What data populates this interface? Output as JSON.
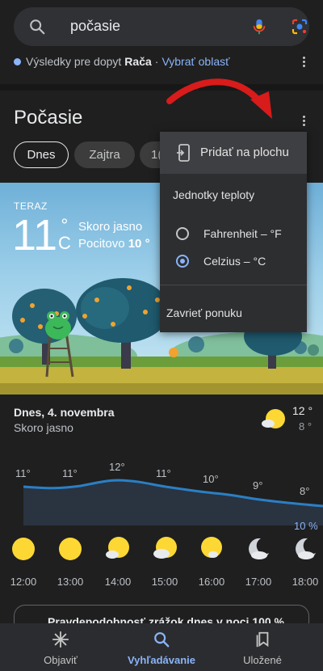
{
  "search": {
    "query": "počasie"
  },
  "results_line": {
    "prefix": "Výsledky pre dopyt",
    "place": "Rača",
    "separator": "·",
    "link": "Vybrať oblasť"
  },
  "card": {
    "title": "Počasie"
  },
  "chips": [
    {
      "label": "Dnes",
      "selected": true
    },
    {
      "label": "Zajtra",
      "selected": false
    },
    {
      "label": "1(",
      "selected": false
    }
  ],
  "now": {
    "label": "TERAZ",
    "temp": "11",
    "degree": "°",
    "unit": "C",
    "condition": "Skoro jasno",
    "feels_prefix": "Pocitovo",
    "feels_value": "10 °"
  },
  "menu": {
    "add_label": "Pridať na plochu",
    "units_heading": "Jednotky teploty",
    "options": [
      {
        "label": "Fahrenheit – °F",
        "selected": false
      },
      {
        "label": "Celzius – °C",
        "selected": true
      }
    ],
    "close_label": "Zavrieť ponuku"
  },
  "day": {
    "date": "Dnes, 4. novembra",
    "condition": "Skoro jasno",
    "high": "12 °",
    "low": "8 °"
  },
  "hourly": [
    {
      "time": "12:00",
      "temp": "11°",
      "icon": "sun"
    },
    {
      "time": "13:00",
      "temp": "11°",
      "icon": "sun"
    },
    {
      "time": "14:00",
      "temp": "12°",
      "icon": "sun-cloud"
    },
    {
      "time": "15:00",
      "temp": "11°",
      "icon": "sun-cloud"
    },
    {
      "time": "16:00",
      "temp": "10°",
      "icon": "sun-cloud"
    },
    {
      "time": "17:00",
      "temp": "9°",
      "icon": "moon-cloud"
    },
    {
      "time": "18:00",
      "temp": "8°",
      "icon": "moon-cloud"
    }
  ],
  "precip_label": "10 %",
  "precip_card": "Pravdepodobnosť zrážok dnes v noci 100 %",
  "nav": [
    {
      "label": "Objaviť",
      "icon": "asterisk-icon",
      "active": false
    },
    {
      "label": "Vyhľadávanie",
      "icon": "search-icon",
      "active": true
    },
    {
      "label": "Uložené",
      "icon": "bookmark-icon",
      "active": false
    }
  ],
  "colors": {
    "accent": "#8ab4f8",
    "background": "#1f1f1f",
    "sun": "#fdd835"
  }
}
